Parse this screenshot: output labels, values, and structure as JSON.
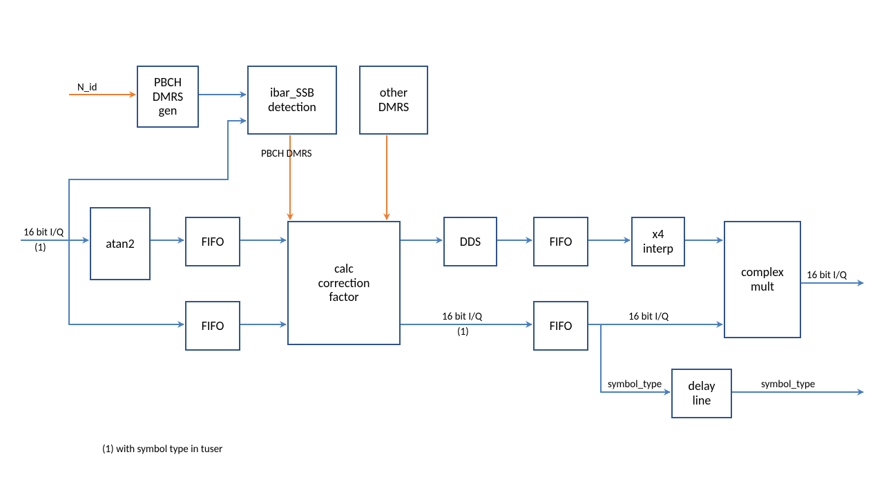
{
  "blocks": {
    "pbch_dmrs_gen": "PBCH\nDMRS\ngen",
    "ibar_ssb_detection": "ibar_SSB\ndetection",
    "other_dmrs": "other\nDMRS",
    "atan2": "atan2",
    "fifo_top": "FIFO",
    "fifo_bottom": "FIFO",
    "calc_correction_factor": "calc\ncorrection\nfactor",
    "dds": "DDS",
    "fifo_upper_chain": "FIFO",
    "x4_interp": "x4\ninterp",
    "fifo_lower_chain": "FIFO",
    "complex_mult": "complex\nmult",
    "delay_line": "delay\nline"
  },
  "labels": {
    "n_id": "N_id",
    "pbch_dmrs": "PBCH DMRS",
    "in_16bit_iq": "16 bit I/Q",
    "in_note1": "(1)",
    "mid_16bit_iq": "16 bit I/Q",
    "mid_note1": "(1)",
    "right_16bit_iq": "16 bit I/Q",
    "out_16bit_iq": "16 bit I/Q",
    "symbol_type_in": "symbol_type",
    "symbol_type_out": "symbol_type",
    "footnote": "(1) with symbol type in tuser"
  },
  "colors": {
    "blue": "#4a7fbf",
    "orange": "#ed7d31",
    "border": "#2f528f"
  }
}
